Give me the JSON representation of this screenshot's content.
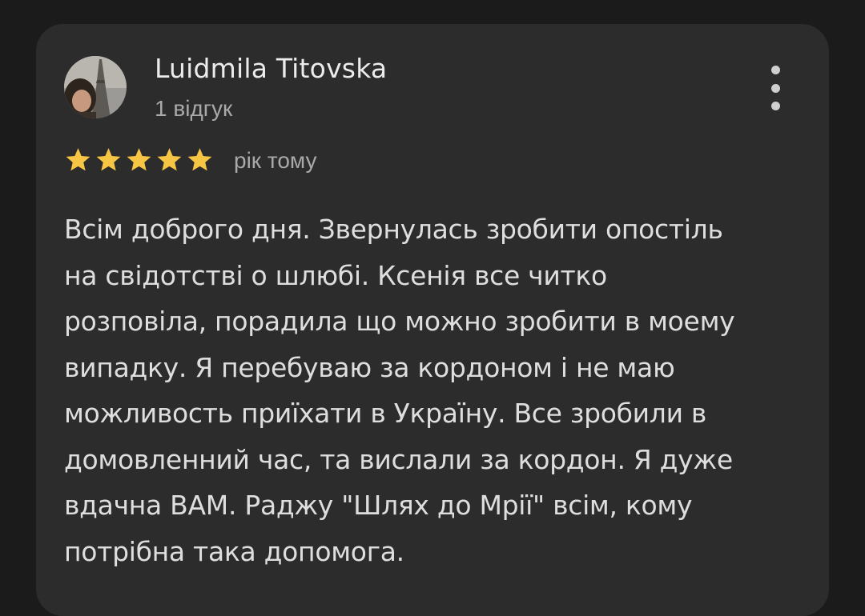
{
  "review": {
    "author": "Luidmila Titovska",
    "review_count": "1 відгук",
    "rating": 5,
    "max_rating": 5,
    "time_ago": "рік тому",
    "text": "Всім доброго дня. Звернулась зробити опостіль\nна свідотстві о шлюбі. Ксенія все читко\nрозповіла, порадила що можно зробити в моему\nвипадку. Я перебуваю за кордоном і не маю\nможливость приїхати в Україну. Все зробили в\nдомовленний час, та вислали за кордон. Я дуже\nвдачна ВАМ. Раджу \"Шлях до Мрії\" всім, кому\nпотрібна така допомога."
  },
  "icons": {
    "avatar": "profile-photo",
    "more": "more-vert-icon",
    "star": "star-icon"
  },
  "colors": {
    "background": "#1b1b1b",
    "card": "#2c2c2c",
    "star": "#f6c544",
    "primary_text": "#ececec",
    "secondary_text": "#a9a9a9"
  }
}
